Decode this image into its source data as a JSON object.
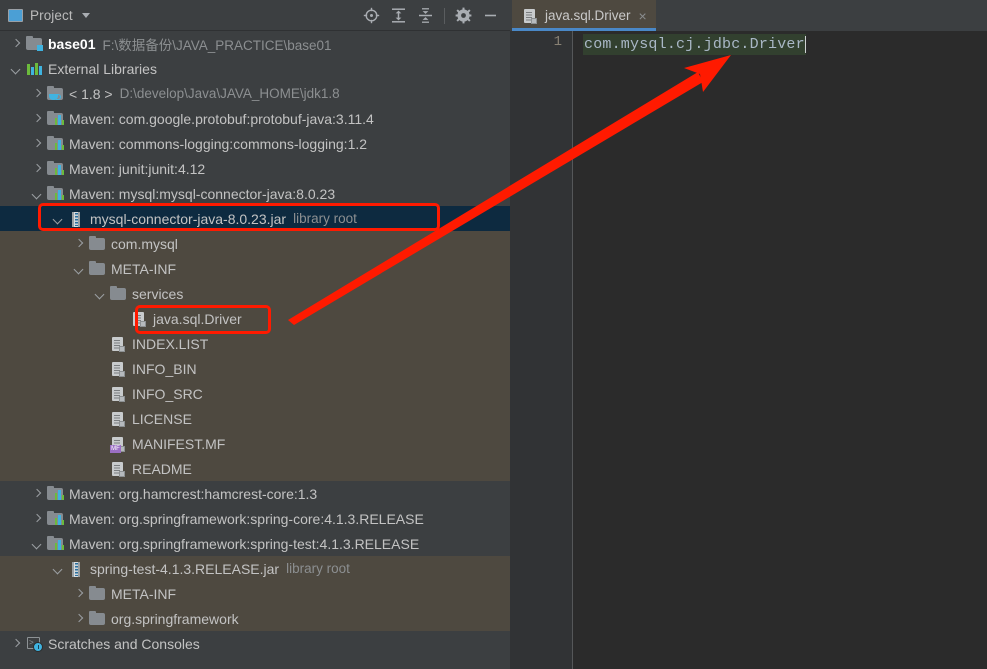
{
  "window": {
    "theme_bg": "#3c3f41",
    "accent_blue": "#4a88c7",
    "annotation_red": "#ff1a00",
    "selection_navy": "#0d2a40",
    "olive_highlight": "#4e4940"
  },
  "panel": {
    "title": "Project",
    "dropdown_caret": "chevron-down-icon",
    "tools": [
      {
        "name": "locate-icon",
        "tooltip": "Select Opened File"
      },
      {
        "name": "expand-all-icon",
        "tooltip": "Expand All"
      },
      {
        "name": "collapse-all-icon",
        "tooltip": "Collapse All"
      },
      {
        "name": "gear-icon",
        "tooltip": "Settings"
      },
      {
        "name": "minimize-icon",
        "tooltip": "Hide"
      }
    ]
  },
  "tree": [
    {
      "indent": 0,
      "arrow": "right",
      "icon": "module-folder-icon",
      "label": "base01",
      "bold": true,
      "sub": "F:\\数据备份\\JAVA_PRACTICE\\base01",
      "state": "normal"
    },
    {
      "indent": 0,
      "arrow": "down",
      "icon": "libraries-icon",
      "label": "External Libraries",
      "bold": false,
      "sub": "",
      "state": "normal"
    },
    {
      "indent": 1,
      "arrow": "right",
      "icon": "jdk-folder-icon",
      "label": "< 1.8 >",
      "bold": false,
      "sub": "D:\\develop\\Java\\JAVA_HOME\\jdk1.8",
      "state": "normal"
    },
    {
      "indent": 1,
      "arrow": "right",
      "icon": "maven-lib-icon",
      "label": "Maven: com.google.protobuf:protobuf-java:3.11.4",
      "bold": false,
      "sub": "",
      "state": "normal"
    },
    {
      "indent": 1,
      "arrow": "right",
      "icon": "maven-lib-icon",
      "label": "Maven: commons-logging:commons-logging:1.2",
      "bold": false,
      "sub": "",
      "state": "normal"
    },
    {
      "indent": 1,
      "arrow": "right",
      "icon": "maven-lib-icon",
      "label": "Maven: junit:junit:4.12",
      "bold": false,
      "sub": "",
      "state": "normal"
    },
    {
      "indent": 1,
      "arrow": "down",
      "icon": "maven-lib-icon",
      "label": "Maven: mysql:mysql-connector-java:8.0.23",
      "bold": false,
      "sub": "",
      "state": "normal"
    },
    {
      "indent": 2,
      "arrow": "down",
      "icon": "jar-icon",
      "label": "mysql-connector-java-8.0.23.jar",
      "bold": false,
      "sub": "library root",
      "state": "selected"
    },
    {
      "indent": 3,
      "arrow": "right",
      "icon": "package-folder-icon",
      "label": "com.mysql",
      "bold": false,
      "sub": "",
      "state": "olive"
    },
    {
      "indent": 3,
      "arrow": "down",
      "icon": "package-folder-icon",
      "label": "META-INF",
      "bold": false,
      "sub": "",
      "state": "olive"
    },
    {
      "indent": 4,
      "arrow": "down",
      "icon": "package-folder-icon",
      "label": "services",
      "bold": false,
      "sub": "",
      "state": "olive"
    },
    {
      "indent": 5,
      "arrow": "none",
      "icon": "file-icon",
      "label": "java.sql.Driver",
      "bold": false,
      "sub": "",
      "state": "olive"
    },
    {
      "indent": 4,
      "arrow": "none",
      "icon": "file-icon",
      "label": "INDEX.LIST",
      "bold": false,
      "sub": "",
      "state": "olive"
    },
    {
      "indent": 4,
      "arrow": "none",
      "icon": "file-icon",
      "label": "INFO_BIN",
      "bold": false,
      "sub": "",
      "state": "olive"
    },
    {
      "indent": 4,
      "arrow": "none",
      "icon": "file-icon",
      "label": "INFO_SRC",
      "bold": false,
      "sub": "",
      "state": "olive"
    },
    {
      "indent": 4,
      "arrow": "none",
      "icon": "file-icon",
      "label": "LICENSE",
      "bold": false,
      "sub": "",
      "state": "olive"
    },
    {
      "indent": 4,
      "arrow": "none",
      "icon": "manifest-file-icon",
      "label": "MANIFEST.MF",
      "bold": false,
      "sub": "",
      "state": "olive"
    },
    {
      "indent": 4,
      "arrow": "none",
      "icon": "file-icon",
      "label": "README",
      "bold": false,
      "sub": "",
      "state": "olive"
    },
    {
      "indent": 1,
      "arrow": "right",
      "icon": "maven-lib-icon",
      "label": "Maven: org.hamcrest:hamcrest-core:1.3",
      "bold": false,
      "sub": "",
      "state": "normal"
    },
    {
      "indent": 1,
      "arrow": "right",
      "icon": "maven-lib-icon",
      "label": "Maven: org.springframework:spring-core:4.1.3.RELEASE",
      "bold": false,
      "sub": "",
      "state": "normal"
    },
    {
      "indent": 1,
      "arrow": "down",
      "icon": "maven-lib-icon",
      "label": "Maven: org.springframework:spring-test:4.1.3.RELEASE",
      "bold": false,
      "sub": "",
      "state": "normal"
    },
    {
      "indent": 2,
      "arrow": "down",
      "icon": "jar-icon",
      "label": "spring-test-4.1.3.RELEASE.jar",
      "bold": false,
      "sub": "library root",
      "state": "olive"
    },
    {
      "indent": 3,
      "arrow": "right",
      "icon": "package-folder-icon",
      "label": "META-INF",
      "bold": false,
      "sub": "",
      "state": "olive"
    },
    {
      "indent": 3,
      "arrow": "right",
      "icon": "package-folder-icon",
      "label": "org.springframework",
      "bold": false,
      "sub": "",
      "state": "olive"
    },
    {
      "indent": 0,
      "arrow": "right",
      "icon": "scratches-icon",
      "label": "Scratches and Consoles",
      "bold": false,
      "sub": "",
      "state": "normal"
    }
  ],
  "editor": {
    "tab": {
      "label": "java.sql.Driver",
      "icon": "file-icon",
      "close_glyph": "×"
    },
    "line_number": "1",
    "code": "com.mysql.cj.jdbc.Driver"
  },
  "annotations": {
    "boxes": [
      {
        "name": "highlight-box-jar",
        "label": "mysql-connector-java-8.0.23.jar"
      },
      {
        "name": "highlight-box-driver",
        "label": "java.sql.Driver"
      }
    ],
    "arrow": {
      "name": "pointer-arrow",
      "from": "java.sql.Driver file node",
      "to": "editor code content"
    }
  }
}
